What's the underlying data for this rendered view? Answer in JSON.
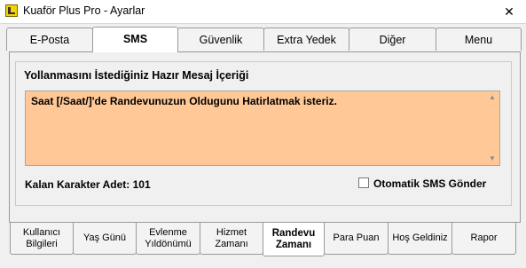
{
  "window": {
    "title": "Kuaför Plus Pro - Ayarlar",
    "close_glyph": "✕"
  },
  "top_tabs": [
    {
      "label": "E-Posta",
      "active": false
    },
    {
      "label": "SMS",
      "active": true
    },
    {
      "label": "Güvenlik",
      "active": false
    },
    {
      "label": "Extra Yedek",
      "active": false
    },
    {
      "label": "Diğer",
      "active": false
    },
    {
      "label": "Menu",
      "active": false
    }
  ],
  "sms": {
    "group_title": "Yollanmasını İstediğiniz Hazır Mesaj İçeriği",
    "message": "Saat [/Saat/]'de Randevunuzun Oldugunu Hatirlatmak isteriz.",
    "counter_label": "Kalan Karakter Adet:",
    "counter_value": "101",
    "auto_send_label": "Otomatik SMS Gönder",
    "auto_send_checked": false
  },
  "bottom_tabs": [
    {
      "label": "Kullanıcı\nBilgileri",
      "active": false
    },
    {
      "label": "Yaş Günü",
      "active": false
    },
    {
      "label": "Evlenme\nYıldönümü",
      "active": false
    },
    {
      "label": "Hizmet\nZamanı",
      "active": false
    },
    {
      "label": "Randevu\nZamanı",
      "active": true
    },
    {
      "label": "Para Puan",
      "active": false
    },
    {
      "label": "Hoş Geldiniz",
      "active": false
    },
    {
      "label": "Rapor",
      "active": false
    }
  ],
  "colors": {
    "message_bg": "#ffc896",
    "window_bg": "#f0f0f0"
  },
  "icons": {
    "app": "app-logo-icon",
    "close": "close-icon",
    "scroll_up": "scroll-up-icon",
    "scroll_down": "scroll-down-icon"
  }
}
